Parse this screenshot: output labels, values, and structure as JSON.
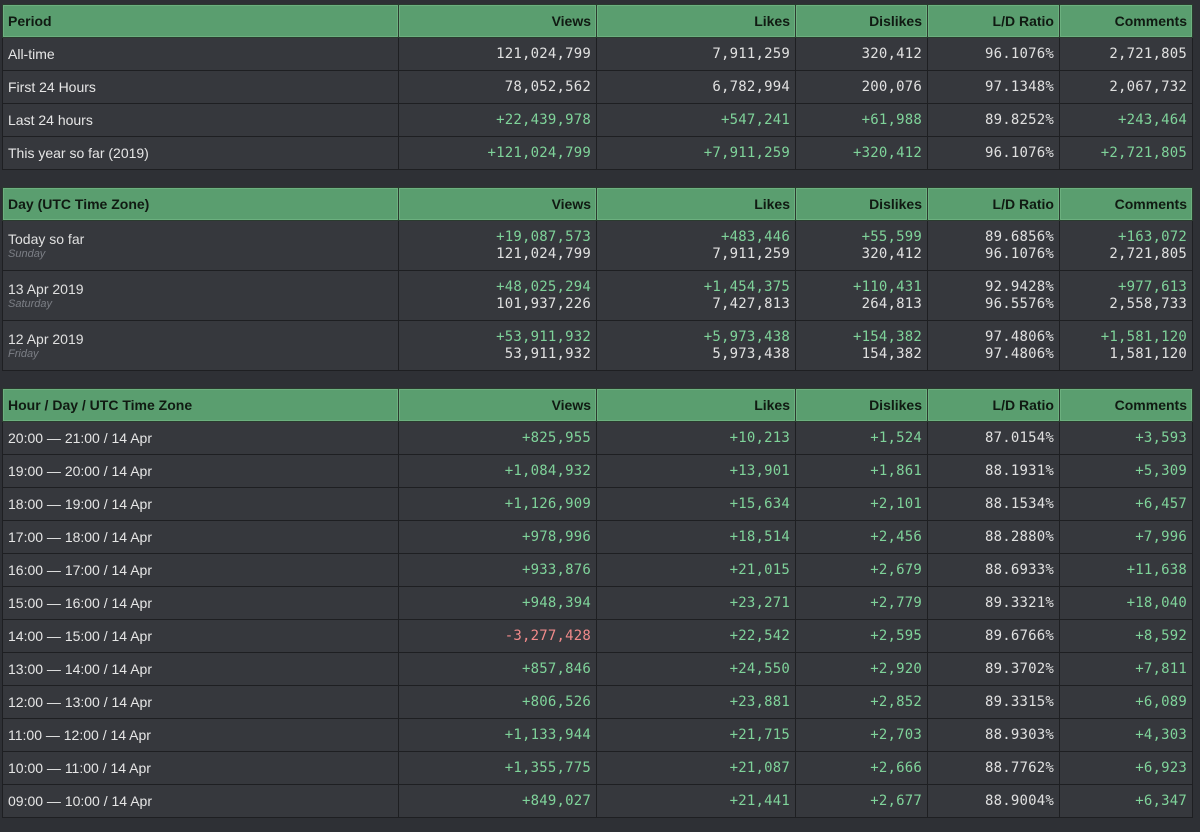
{
  "period_table": {
    "headers": [
      "Period",
      "Views",
      "Likes",
      "Dislikes",
      "L/D Ratio",
      "Comments"
    ],
    "rows": [
      {
        "label": "All-time",
        "views": "121,024,799",
        "likes": "7,911,259",
        "dislikes": "320,412",
        "ratio": "96.1076%",
        "comments": "2,721,805"
      },
      {
        "label": "First 24 Hours",
        "views": "78,052,562",
        "likes": "6,782,994",
        "dislikes": "200,076",
        "ratio": "97.1348%",
        "comments": "2,067,732"
      },
      {
        "label": "Last 24 hours",
        "views": "+22,439,978",
        "likes": "+547,241",
        "dislikes": "+61,988",
        "ratio": "89.8252%",
        "comments": "+243,464"
      },
      {
        "label": "This year so far (2019)",
        "views": "+121,024,799",
        "likes": "+7,911,259",
        "dislikes": "+320,412",
        "ratio": "96.1076%",
        "comments": "+2,721,805"
      }
    ]
  },
  "day_table": {
    "headers": [
      "Day (UTC Time Zone)",
      "Views",
      "Likes",
      "Dislikes",
      "L/D Ratio",
      "Comments"
    ],
    "rows": [
      {
        "label": "Today so far",
        "weekday": "Sunday",
        "views_delta": "+19,087,573",
        "views_total": "121,024,799",
        "likes_delta": "+483,446",
        "likes_total": "7,911,259",
        "dislikes_delta": "+55,599",
        "dislikes_total": "320,412",
        "ratio_day": "89.6856%",
        "ratio_total": "96.1076%",
        "comments_delta": "+163,072",
        "comments_total": "2,721,805"
      },
      {
        "label": "13 Apr 2019",
        "weekday": "Saturday",
        "views_delta": "+48,025,294",
        "views_total": "101,937,226",
        "likes_delta": "+1,454,375",
        "likes_total": "7,427,813",
        "dislikes_delta": "+110,431",
        "dislikes_total": "264,813",
        "ratio_day": "92.9428%",
        "ratio_total": "96.5576%",
        "comments_delta": "+977,613",
        "comments_total": "2,558,733"
      },
      {
        "label": "12 Apr 2019",
        "weekday": "Friday",
        "views_delta": "+53,911,932",
        "views_total": "53,911,932",
        "likes_delta": "+5,973,438",
        "likes_total": "5,973,438",
        "dislikes_delta": "+154,382",
        "dislikes_total": "154,382",
        "ratio_day": "97.4806%",
        "ratio_total": "97.4806%",
        "comments_delta": "+1,581,120",
        "comments_total": "1,581,120"
      }
    ]
  },
  "hour_table": {
    "headers": [
      "Hour / Day / UTC Time Zone",
      "Views",
      "Likes",
      "Dislikes",
      "L/D Ratio",
      "Comments"
    ],
    "rows": [
      {
        "label": "20:00 — 21:00 / 14 Apr",
        "views": "+825,955",
        "likes": "+10,213",
        "dislikes": "+1,524",
        "ratio": "87.0154%",
        "comments": "+3,593"
      },
      {
        "label": "19:00 — 20:00 / 14 Apr",
        "views": "+1,084,932",
        "likes": "+13,901",
        "dislikes": "+1,861",
        "ratio": "88.1931%",
        "comments": "+5,309"
      },
      {
        "label": "18:00 — 19:00 / 14 Apr",
        "views": "+1,126,909",
        "likes": "+15,634",
        "dislikes": "+2,101",
        "ratio": "88.1534%",
        "comments": "+6,457"
      },
      {
        "label": "17:00 — 18:00 / 14 Apr",
        "views": "+978,996",
        "likes": "+18,514",
        "dislikes": "+2,456",
        "ratio": "88.2880%",
        "comments": "+7,996"
      },
      {
        "label": "16:00 — 17:00 / 14 Apr",
        "views": "+933,876",
        "likes": "+21,015",
        "dislikes": "+2,679",
        "ratio": "88.6933%",
        "comments": "+11,638"
      },
      {
        "label": "15:00 — 16:00 / 14 Apr",
        "views": "+948,394",
        "likes": "+23,271",
        "dislikes": "+2,779",
        "ratio": "89.3321%",
        "comments": "+18,040"
      },
      {
        "label": "14:00 — 15:00 / 14 Apr",
        "views": "-3,277,428",
        "likes": "+22,542",
        "dislikes": "+2,595",
        "ratio": "89.6766%",
        "comments": "+8,592"
      },
      {
        "label": "13:00 — 14:00 / 14 Apr",
        "views": "+857,846",
        "likes": "+24,550",
        "dislikes": "+2,920",
        "ratio": "89.3702%",
        "comments": "+7,811"
      },
      {
        "label": "12:00 — 13:00 / 14 Apr",
        "views": "+806,526",
        "likes": "+23,881",
        "dislikes": "+2,852",
        "ratio": "89.3315%",
        "comments": "+6,089"
      },
      {
        "label": "11:00 — 12:00 / 14 Apr",
        "views": "+1,133,944",
        "likes": "+21,715",
        "dislikes": "+2,703",
        "ratio": "88.9303%",
        "comments": "+4,303"
      },
      {
        "label": "10:00 — 11:00 / 14 Apr",
        "views": "+1,355,775",
        "likes": "+21,087",
        "dislikes": "+2,666",
        "ratio": "88.7762%",
        "comments": "+6,923"
      },
      {
        "label": "09:00 — 10:00 / 14 Apr",
        "views": "+849,027",
        "likes": "+21,441",
        "dislikes": "+2,677",
        "ratio": "88.9004%",
        "comments": "+6,347"
      }
    ]
  },
  "colors": {
    "header_bg": "#5a9e6f",
    "positive": "#7fd39a",
    "negative": "#f08a8a",
    "row_bg": "#36383d",
    "page_bg": "#2e3035"
  }
}
